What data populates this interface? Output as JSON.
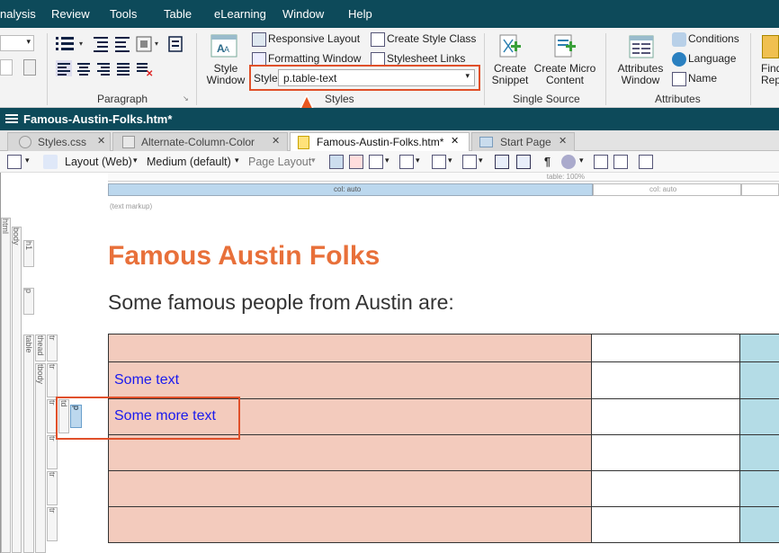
{
  "menu": [
    "nalysis",
    "Review",
    "Tools",
    "Table",
    "eLearning",
    "Window",
    "Help"
  ],
  "ribbon": {
    "style_window": "Style\nWindow",
    "responsive_layout": "Responsive Layout",
    "formatting_window": "Formatting Window",
    "create_style_class": "Create Style Class",
    "stylesheet_links": "Stylesheet Links",
    "style_label": "Style",
    "style_value": "p.table-text",
    "styles_group": "Styles",
    "paragraph_group": "Paragraph",
    "create_snippet": "Create\nSnippet",
    "create_micro_content": "Create Micro\nContent",
    "single_source_group": "Single Source",
    "attributes_window": "Attributes\nWindow",
    "conditions": "Conditions",
    "language": "Language",
    "name": "Name",
    "attributes_group": "Attributes",
    "find_partial": "Find\nRep"
  },
  "docbar": {
    "title": "Famous-Austin-Folks.htm*"
  },
  "tabs": [
    {
      "label": "Styles.css",
      "active": false
    },
    {
      "label": "Alternate-Column-Color",
      "active": false
    },
    {
      "label": "Famous-Austin-Folks.htm*",
      "active": true
    },
    {
      "label": "Start Page",
      "active": false
    }
  ],
  "toolbar": {
    "layout": "Layout (Web)",
    "medium": "Medium (default)",
    "page_layout": "Page Layout"
  },
  "ruler": {
    "table": "table: 100%",
    "col1": "col: auto",
    "col2": "col: auto"
  },
  "markup_note": "(text markup)",
  "structure_tags": [
    "html",
    "body",
    "h1",
    "p",
    "table",
    "thead",
    "tr",
    "tbody",
    "tr",
    "tr",
    "td",
    "p",
    "tr",
    "tr",
    "tr"
  ],
  "content": {
    "heading": "Famous Austin Folks",
    "intro": "Some famous people from Austin are:",
    "rows": [
      "",
      "Some text",
      "Some more text",
      "",
      "",
      ""
    ]
  },
  "colors": {
    "accent": "#e8703a",
    "menubar": "#0d4a5a",
    "highlight": "#e0502a",
    "cell_pink": "#f3cbbd",
    "cell_blue": "#b4dce6",
    "link_text": "#1a1aee"
  }
}
